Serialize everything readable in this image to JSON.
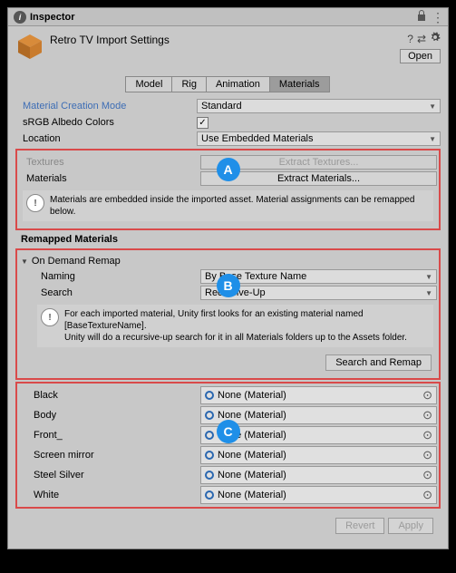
{
  "titlebar": {
    "title": "Inspector"
  },
  "header": {
    "asset_title": "Retro TV Import Settings",
    "open_label": "Open"
  },
  "tabs": {
    "model": "Model",
    "rig": "Rig",
    "animation": "Animation",
    "materials": "Materials"
  },
  "material_mode": {
    "label": "Material Creation Mode",
    "value": "Standard"
  },
  "srgb": {
    "label": "sRGB Albedo Colors",
    "checked": "✓"
  },
  "location": {
    "label": "Location",
    "value": "Use Embedded Materials"
  },
  "sectionA": {
    "textures_label": "Textures",
    "textures_btn": "Extract Textures...",
    "materials_label": "Materials",
    "materials_btn": "Extract Materials...",
    "info": "Materials are embedded inside the imported asset. Material assignments can be remapped below.",
    "badge": "A"
  },
  "remapped_heading": "Remapped Materials",
  "sectionB": {
    "foldout": "On Demand Remap",
    "naming_label": "Naming",
    "naming_value": "By Base Texture Name",
    "search_label": "Search",
    "search_value": "Recursive-Up",
    "info": "For each imported material, Unity first looks for an existing material named [BaseTextureName].\nUnity will do a recursive-up search for it in all Materials folders up to the Assets folder.",
    "search_remap_btn": "Search and Remap",
    "badge": "B"
  },
  "sectionC": {
    "badge": "C",
    "slots": [
      {
        "name": "Black",
        "value": "None (Material)"
      },
      {
        "name": "Body",
        "value": "None (Material)"
      },
      {
        "name": "Front_",
        "value": "None (Material)"
      },
      {
        "name": "Screen mirror",
        "value": "None (Material)"
      },
      {
        "name": "Steel Silver",
        "value": "None (Material)"
      },
      {
        "name": "White",
        "value": "None (Material)"
      }
    ]
  },
  "footer": {
    "revert": "Revert",
    "apply": "Apply"
  }
}
